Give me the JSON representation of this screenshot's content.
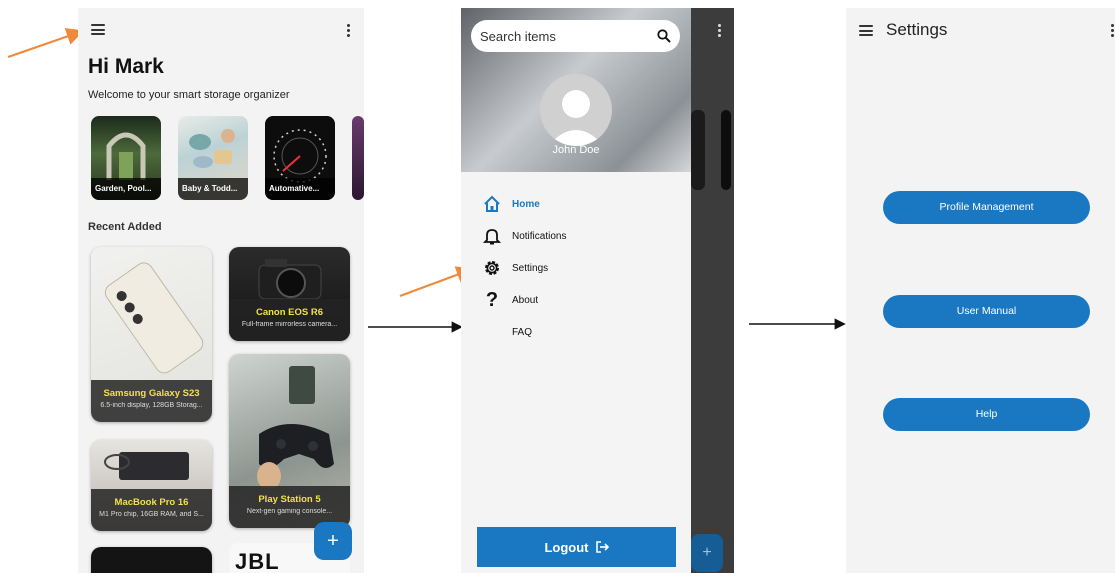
{
  "home": {
    "greeting": "Hi Mark",
    "welcome": "Welcome to your smart storage organizer",
    "categories": [
      "Garden, Pool...",
      "Baby & Todd...",
      "Automative..."
    ],
    "recent_title": "Recent Added",
    "items": [
      {
        "title": "Samsung Galaxy S23",
        "desc": "6.5-inch display, 128GB Storag..."
      },
      {
        "title": "Canon EOS R6",
        "desc": "Full-frame mirrorless camera..."
      },
      {
        "title": "MacBook Pro 16",
        "desc": "M1 Pro chip, 16GB RAM, and S..."
      },
      {
        "title": "Play Station 5",
        "desc": "Next-gen gaming console..."
      }
    ],
    "partial_text": "JBL",
    "fab": "+"
  },
  "drawer": {
    "search_placeholder": "Search items",
    "user_name": "John Doe",
    "nav": [
      "Home",
      "Notifications",
      "Settings",
      "About",
      "FAQ"
    ],
    "logout": "Logout"
  },
  "settings": {
    "title": "Settings",
    "buttons": [
      "Profile Management",
      "User Manual",
      "Help"
    ]
  },
  "colors": {
    "accent": "#1a78c2",
    "annotation_arrow": "#ef8a3c",
    "caption_title": "#f4e04a"
  }
}
